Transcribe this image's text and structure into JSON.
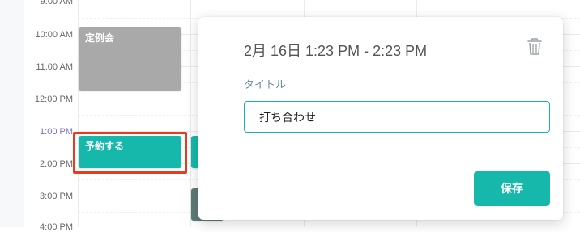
{
  "time_axis": {
    "labels": [
      "9:00 AM",
      "10:00 AM",
      "11:00 AM",
      "12:00 PM",
      "1:00 PM",
      "2:00 PM",
      "3:00 PM",
      "4:00 PM"
    ]
  },
  "events": [
    {
      "title": "定例会",
      "color": "#a9a9a9"
    },
    {
      "title": "予約する",
      "color": "#16b8ac"
    },
    {
      "title": "",
      "color": "#16b8ac"
    },
    {
      "title": "",
      "color": "#5f7a78"
    }
  ],
  "popover": {
    "date_range": "2月 16日 1:23 PM - 2:23 PM",
    "title_label": "タイトル",
    "title_value": "打ち合わせ",
    "save_label": "保存",
    "delete_icon": "trash-icon"
  },
  "colors": {
    "accent": "#16b8ac",
    "highlight": "#e83a1f",
    "current_time": "#7b6fc2"
  }
}
